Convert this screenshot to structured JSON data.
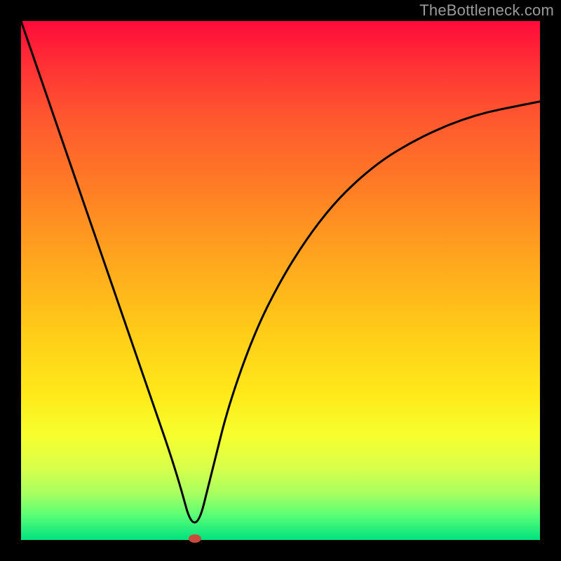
{
  "watermark": "TheBottleneck.com",
  "chart_data": {
    "type": "line",
    "title": "",
    "xlabel": "",
    "ylabel": "",
    "xlim": [
      0,
      100
    ],
    "ylim": [
      0,
      100
    ],
    "series": [
      {
        "name": "curve",
        "x": [
          0,
          5,
          10,
          15,
          20,
          25,
          30,
          33.5,
          37,
          40,
          45,
          50,
          55,
          60,
          65,
          70,
          75,
          80,
          85,
          90,
          95,
          100
        ],
        "y": [
          100,
          85.5,
          71,
          56.5,
          42,
          27.5,
          13,
          0,
          14,
          26,
          40,
          50,
          58,
          64.5,
          69.5,
          73.5,
          76.5,
          79,
          81,
          82.5,
          83.5,
          84.5
        ]
      }
    ],
    "marker": {
      "x": 33.5,
      "y": 0,
      "color": "#c94a3a",
      "rx": 9,
      "ry": 6
    },
    "gradient_stops": [
      {
        "pos": 0,
        "color": "#ff0a3a"
      },
      {
        "pos": 8,
        "color": "#ff2f35"
      },
      {
        "pos": 18,
        "color": "#ff5530"
      },
      {
        "pos": 30,
        "color": "#ff7726"
      },
      {
        "pos": 45,
        "color": "#ffa31e"
      },
      {
        "pos": 60,
        "color": "#ffcc18"
      },
      {
        "pos": 72,
        "color": "#ffe91a"
      },
      {
        "pos": 80,
        "color": "#f6ff2e"
      },
      {
        "pos": 86,
        "color": "#d9ff4a"
      },
      {
        "pos": 91,
        "color": "#a8ff60"
      },
      {
        "pos": 95,
        "color": "#5eff76"
      },
      {
        "pos": 100,
        "color": "#00e27e"
      }
    ]
  }
}
